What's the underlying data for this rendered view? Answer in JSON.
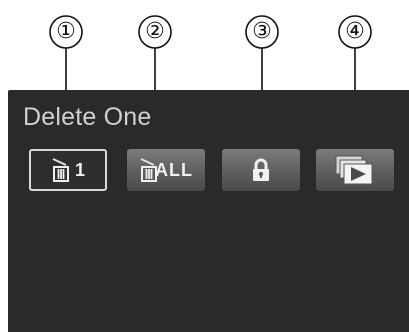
{
  "callouts": [
    "①",
    "②",
    "③",
    "④"
  ],
  "screen": {
    "title": "Delete One"
  },
  "menu": {
    "items": [
      {
        "id": "delete-one",
        "label": "1",
        "icon": "trash-icon",
        "selected": true
      },
      {
        "id": "delete-all",
        "label": "ALL",
        "icon": "trash-icon",
        "selected": false
      },
      {
        "id": "protect",
        "label": "",
        "icon": "lock-icon",
        "selected": false
      },
      {
        "id": "slideshow",
        "label": "",
        "icon": "slideshow-icon",
        "selected": false
      }
    ]
  },
  "colors": {
    "screen_bg": "#2a2a2a",
    "title_text": "#d0d0d0",
    "button_gradient_top": "#7c7c7c",
    "button_gradient_bottom": "#4a4a4a",
    "selected_border": "#d8d8d8"
  }
}
